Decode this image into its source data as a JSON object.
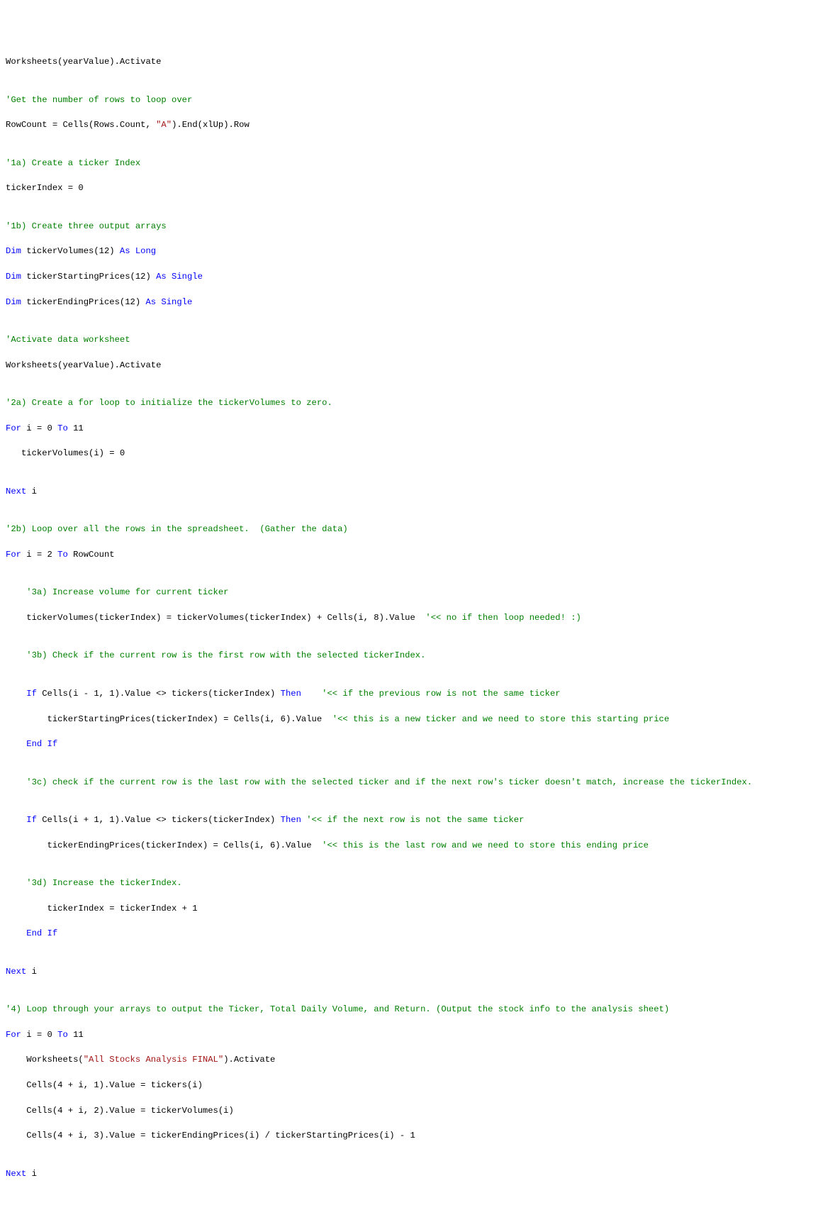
{
  "code": {
    "l1_a": "Worksheets(yearValue).Activate",
    "l3_c": "'Get the number of rows to loop over",
    "l4_a": "RowCount = Cells(Rows.Count, ",
    "l4_s": "\"A\"",
    "l4_b": ").End(xlUp).Row",
    "l6_c": "'1a) Create a ticker Index",
    "l7_a": "tickerIndex = 0",
    "l9_c": "'1b) Create three output arrays",
    "l10_k": "Dim",
    "l10_a": " tickerVolumes(12) ",
    "l10_k2": "As Long",
    "l11_k": "Dim",
    "l11_a": " tickerStartingPrices(12) ",
    "l11_k2": "As Single",
    "l12_k": "Dim",
    "l12_a": " tickerEndingPrices(12) ",
    "l12_k2": "As Single",
    "l14_c": "'Activate data worksheet",
    "l15_a": "Worksheets(yearValue).Activate",
    "l17_c": "'2a) Create a for loop to initialize the tickerVolumes to zero.",
    "l18_k": "For",
    "l18_a": " i = 0 ",
    "l18_k2": "To",
    "l18_b": " 11",
    "l19_a": "   tickerVolumes(i) = 0",
    "l21_k": "Next",
    "l21_a": " i",
    "l23_c": "'2b) Loop over all the rows in the spreadsheet.  (Gather the data)",
    "l24_k": "For",
    "l24_a": " i = 2 ",
    "l24_k2": "To",
    "l24_b": " RowCount",
    "l26_c": "    '3a) Increase volume for current ticker",
    "l27_a": "    tickerVolumes(tickerIndex) = tickerVolumes(tickerIndex) + Cells(i, 8).Value  ",
    "l27_c": "'<< no if then loop needed! :)",
    "l29_c": "    '3b) Check if the current row is the first row with the selected tickerIndex.",
    "l31_k": "    If",
    "l31_a": " Cells(i - 1, 1).Value <> tickers(tickerIndex) ",
    "l31_k2": "Then",
    "l31_c": "    '<< if the previous row is not the same ticker",
    "l32_a": "        tickerStartingPrices(tickerIndex) = Cells(i, 6).Value  ",
    "l32_c": "'<< this is a new ticker and we need to store this starting price",
    "l33_k": "    End If",
    "l35_c": "    '3c) check if the current row is the last row with the selected ticker and if the next row's ticker doesn't match, increase the tickerIndex.",
    "l37_k": "    If",
    "l37_a": " Cells(i + 1, 1).Value <> tickers(tickerIndex) ",
    "l37_k2": "Then ",
    "l37_c": "'<< if the next row is not the same ticker",
    "l38_a": "        tickerEndingPrices(tickerIndex) = Cells(i, 6).Value  ",
    "l38_c": "'<< this is the last row and we need to store this ending price",
    "l40_c": "    '3d) Increase the tickerIndex.",
    "l41_a": "        tickerIndex = tickerIndex + 1",
    "l42_k": "    End If",
    "l44_k": "Next",
    "l44_a": " i",
    "l46_c": "'4) Loop through your arrays to output the Ticker, Total Daily Volume, and Return. (Output the stock info to the analysis sheet)",
    "l47_k": "For",
    "l47_a": " i = 0 ",
    "l47_k2": "To",
    "l47_b": " 11",
    "l48_a": "    Worksheets(",
    "l48_s": "\"All Stocks Analysis FINAL\"",
    "l48_b": ").Activate",
    "l49_a": "    Cells(4 + i, 1).Value = tickers(i)",
    "l50_a": "    Cells(4 + i, 2).Value = tickerVolumes(i)",
    "l51_a": "    Cells(4 + i, 3).Value = tickerEndingPrices(i) / tickerStartingPrices(i) - 1",
    "l53_k": "Next",
    "l53_a": " i"
  }
}
